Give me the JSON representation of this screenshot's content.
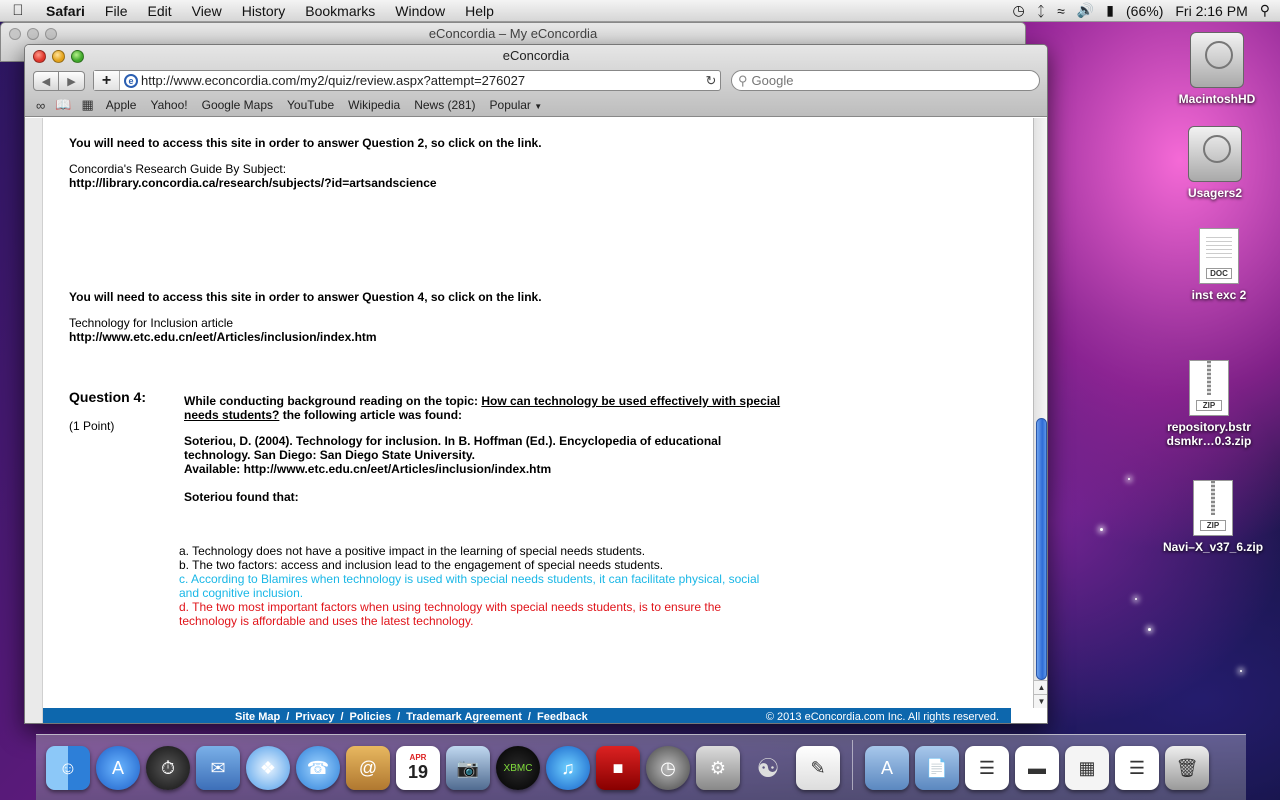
{
  "menubar": {
    "app": "Safari",
    "items": [
      "File",
      "Edit",
      "View",
      "History",
      "Bookmarks",
      "Window",
      "Help"
    ],
    "battery": "(66%)",
    "clock": "Fri 2:16 PM"
  },
  "background_window": {
    "title": "eConcordia – My eConcordia"
  },
  "window": {
    "title": "eConcordia",
    "url": "http://www.econcordia.com/my2/quiz/review.aspx?attempt=276027",
    "search_placeholder": "Google",
    "bookmarks": [
      "Apple",
      "Yahoo!",
      "Google Maps",
      "YouTube",
      "Wikipedia",
      "News (281)",
      "Popular"
    ]
  },
  "content": {
    "q2_note": "You will need to access this site in order to answer Question 2, so click on the link.",
    "q2_link_label": "Concordia's Research Guide By Subject:",
    "q2_link_url": "http://library.concordia.ca/research/subjects/?id=artsandscience",
    "q4_note": "You will need to access this site in order to answer Question 4, so click on the link.",
    "q4_link_label": "Technology for Inclusion article",
    "q4_link_url": "http://www.etc.edu.cn/eet/Articles/inclusion/index.htm",
    "question_title": "Question 4:",
    "question_points": "(1 Point)",
    "question_intro": "While conducting background reading on the topic:",
    "question_topic_1": "How can technology be used effectively with special",
    "question_topic_2": "needs students?",
    "question_intro_end": "the following article was found:",
    "citation_1": "Soteriou, D. (2004). Technology for inclusion. In B. Hoffman (Ed.). Encyclopedia of educational",
    "citation_2": "technology. San Diego: San Diego State University.",
    "citation_3": "Available: http://www.etc.edu.cn/eet/Articles/inclusion/index.htm",
    "prompt": "Soteriou found that:",
    "options": [
      {
        "line1": "a. Technology does not have a positive impact in the learning of special needs students.",
        "line2": ""
      },
      {
        "line1": "b. The two factors: access and inclusion lead to the engagement of special needs students.",
        "line2": ""
      },
      {
        "line1": "c. According to Blamires when technology is used with special needs students, it can facilitate physical, social",
        "line2": "and cognitive inclusion."
      },
      {
        "line1": "d. The two most important factors when using technology with special needs students, is to ensure the",
        "line2": "technology is affordable and uses the latest technology."
      }
    ]
  },
  "footer": {
    "links": [
      "Site Map",
      "Privacy",
      "Policies",
      "Trademark Agreement",
      "Feedback"
    ],
    "separator": "/",
    "copyright": "© 2013 eConcordia.com Inc. All rights reserved."
  },
  "desktop": {
    "icons": [
      {
        "label": "MacintoshHD",
        "type": "drive"
      },
      {
        "label": "Usagers2",
        "type": "drive"
      },
      {
        "label": "inst exc 2",
        "type": "doc",
        "badge": "DOC"
      },
      {
        "label": "repository.bstr dsmkr…0.3.zip",
        "type": "zip",
        "badge": "ZIP"
      },
      {
        "label": "Navi–X_v37_6.zip",
        "type": "zip",
        "badge": "ZIP"
      }
    ]
  },
  "dock": {
    "calendar_month": "APR",
    "calendar_day": "19",
    "xbmc_label": "XBMC"
  }
}
